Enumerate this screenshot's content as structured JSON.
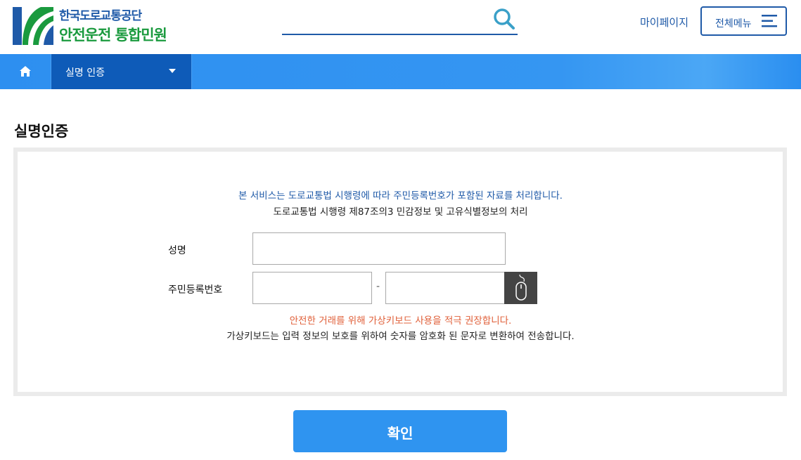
{
  "header": {
    "logo": {
      "top": "한국도로교통공단",
      "bottom": "안전운전 통합민원"
    },
    "search": {
      "value": "",
      "icon": "search-icon"
    },
    "mypage_label": "마이페이지",
    "allmenu_label": "전체메뉴"
  },
  "nav": {
    "home_icon": "home-icon",
    "current": "실명 인증"
  },
  "page": {
    "title": "실명인증",
    "notice_primary": "본 서비스는 도로교통법 시행령에 따라 주민등록번호가 포함된 자료를 처리합니다.",
    "notice_secondary": "도로교통법 시행령 제87조의3 민감정보 및 고유식별정보의 처리",
    "form": {
      "name_label": "성명",
      "name_value": "",
      "rrn_label": "주민등록번호",
      "rrn_first_value": "",
      "rrn_separator": "-",
      "rrn_second_value": "",
      "virtual_keyboard_icon": "mouse-icon"
    },
    "warning": "안전한 거래를 위해 가상키보드 사용을 적극 권장합니다.",
    "info": "가상키보드는 입력 정보의 보호를 위하여 숫자를 암호화 된 문자로 변환하여 전송합니다.",
    "confirm_label": "확인"
  },
  "colors": {
    "brand_blue": "#1f5aa8",
    "brand_green": "#1a9a3e",
    "nav_blue": "#2d8ff0",
    "nav_dark": "#0e5bb8",
    "warning": "#e0603a",
    "button": "#2f94f0"
  }
}
